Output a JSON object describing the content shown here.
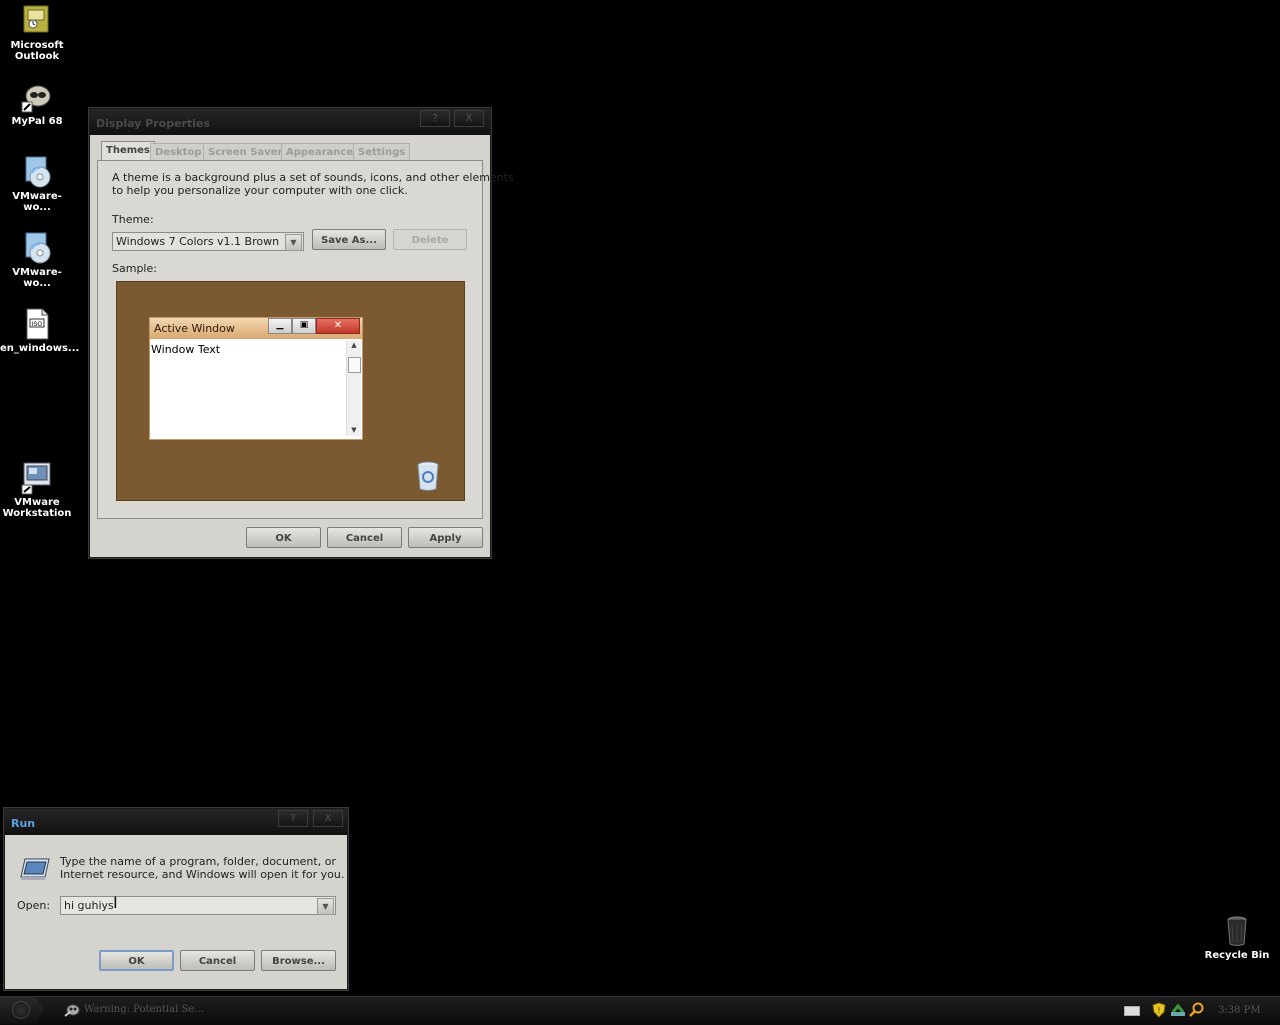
{
  "desktop": {
    "icons": [
      {
        "label_line1": "Microsoft",
        "label_line2": "Outlook"
      },
      {
        "label_line1": "MyPal 68",
        "label_line2": ""
      },
      {
        "label_line1": "VMware-wo...",
        "label_line2": ""
      },
      {
        "label_line1": "VMware-wo...",
        "label_line2": ""
      },
      {
        "label_line1": "en_windows...",
        "label_line2": ""
      },
      {
        "label_line1": "VMware",
        "label_line2": "Workstation"
      },
      {
        "label_line1": "Recycle Bin",
        "label_line2": ""
      }
    ]
  },
  "display_properties": {
    "title": "Display Properties",
    "help_btn": "?",
    "close_btn": "X",
    "tabs": [
      "Themes",
      "Desktop",
      "Screen Saver",
      "Appearance",
      "Settings"
    ],
    "description_line1": "A theme is a background plus a set of sounds, icons, and other elements",
    "description_line2": "to help you personalize your computer with one click.",
    "theme_label": "Theme:",
    "theme_value": "Windows 7 Colors v1.1 Brown",
    "save_as_label": "Save As...",
    "delete_label": "Delete",
    "sample_label": "Sample:",
    "sample": {
      "window_title": "Active Window",
      "window_text": "Window Text",
      "background_color": "#7b5a32"
    },
    "ok_label": "OK",
    "cancel_label": "Cancel",
    "apply_label": "Apply"
  },
  "run_dialog": {
    "title": "Run",
    "help_btn": "?",
    "close_btn": "X",
    "description_line1": "Type the name of a program, folder, document, or",
    "description_line2": "Internet resource, and Windows will open it for you.",
    "open_label": "Open:",
    "open_value": "hi guhiys",
    "ok_label": "OK",
    "cancel_label": "Cancel",
    "browse_label": "Browse..."
  },
  "taskbar": {
    "task_label": "Warning: Potential Se...",
    "clock": "3:38 PM"
  },
  "colors": {
    "desktop": "#000000",
    "dialog_bg": "#d4d3cd",
    "run_title": "#5aa0e0"
  }
}
